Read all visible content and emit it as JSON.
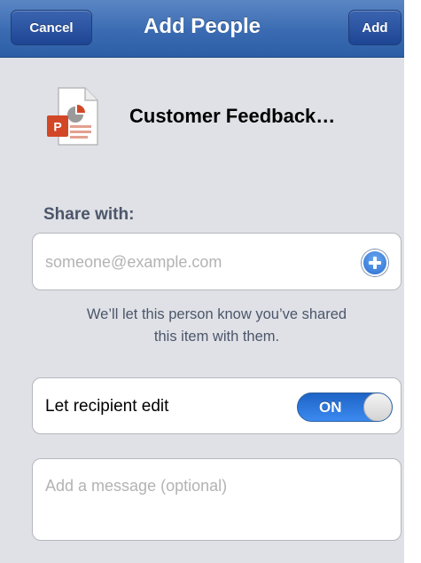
{
  "navbar": {
    "title": "Add People",
    "cancel_label": "Cancel",
    "add_label": "Add",
    "accent": "#3a6bb2"
  },
  "document": {
    "title": "Customer Feedback…",
    "icon": "powerpoint-file-icon",
    "icon_letter": "P",
    "icon_color": "#d24726"
  },
  "share": {
    "label": "Share with:",
    "email_placeholder": "someone@example.com",
    "add_contact_icon": "plus-circle-icon",
    "hint": "We’ll let this person know you’ve shared\nthis item with them."
  },
  "edit_permission": {
    "label": "Let recipient edit",
    "toggle_text": "ON",
    "enabled": true
  },
  "message": {
    "placeholder": "Add a message (optional)"
  },
  "background": "#dfe1e6"
}
